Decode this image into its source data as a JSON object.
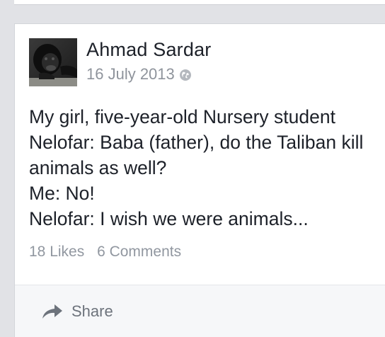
{
  "post": {
    "author": "Ahmad Sardar",
    "date": "16 July 2013",
    "privacy_icon": "globe-icon",
    "avatar_icon": "chimpanzee-avatar",
    "lines": [
      "My girl, five-year-old Nursery student",
      "Nelofar: Baba (father), do the Taliban kill",
      "animals as well?",
      "Me: No!",
      "Nelofar: I wish we were animals..."
    ],
    "likes": "18 Likes",
    "comments": "6 Comments"
  },
  "actions": {
    "share_label": "Share",
    "share_icon": "share-arrow-icon"
  },
  "colors": {
    "page_bg": "#e1e2e6",
    "card_bg": "#ffffff",
    "text": "#1d2129",
    "muted": "#8f949c",
    "action_bar_bg": "#f6f7f9"
  }
}
